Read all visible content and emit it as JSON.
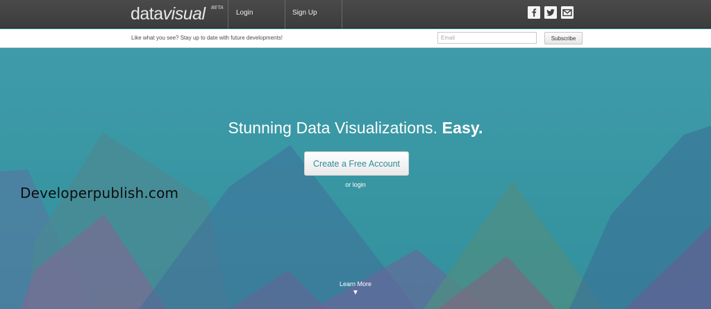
{
  "header": {
    "logo_part1": "data",
    "logo_part2": "visual",
    "logo_badge": "BETA",
    "nav": [
      {
        "label": "Login"
      },
      {
        "label": "Sign Up"
      }
    ],
    "social_icons": [
      "facebook-icon",
      "twitter-icon",
      "mail-icon"
    ]
  },
  "subscribe": {
    "tagline": "Like what you see? Stay up to date with future developments!",
    "email_placeholder": "Email",
    "button_label": "Subscribe"
  },
  "hero": {
    "headline_regular": "Stunning Data Visualizations.",
    "headline_strong": "Easy.",
    "cta_label": "Create a Free Account",
    "secondary_link": "or login",
    "learn_more": "Learn More",
    "learn_more_arrow": "▼",
    "watermark": "Developerpublish.com"
  },
  "colors": {
    "topbar": "#444444",
    "hero_bg": "#3a9aa6",
    "cta_text": "#2f8c99"
  }
}
